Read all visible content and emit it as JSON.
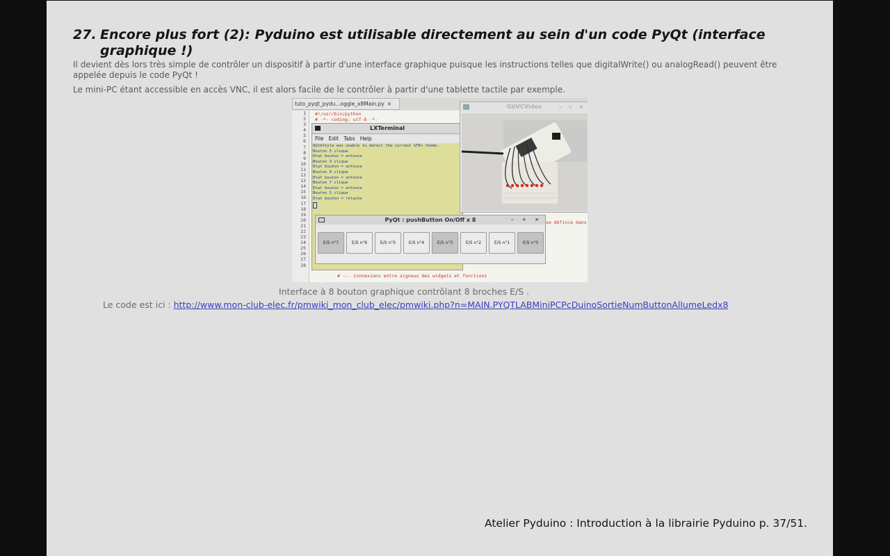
{
  "slide": {
    "heading_number": "27.",
    "heading_text": "Encore plus fort (2): Pyduino est utilisable directement au sein d'un code PyQt (interface graphique !)",
    "para1": "Il devient dès lors très simple de contrôler un dispositif à partir d'une interface graphique puisque les instructions telles que digitalWrite() ou analogRead() peuvent être appelée depuis le code PyQt !",
    "para2": "Le mini-PC étant accessible en accès VNC, il est alors facile de le contrôler à partir d'une tablette tactile par exemple.",
    "caption": "Interface à 8 bouton graphique contrôlant 8 broches E/S .",
    "code_prefix": "Le code est ici : ",
    "code_link": "http://www.mon-club-elec.fr/pmwiki_mon_club_elec/pmwiki.php?n=MAIN.PYQTLABMiniPCPcDuinoSortieNumButtonAllumeLedx8",
    "footer": "Atelier Pyduino : Introduction à la librairie Pyduino p. 37/51."
  },
  "screenshot": {
    "editor_tab": "tuto_pyqt_pydu...oggle_x8Main.py",
    "editor_tab_close": "×",
    "line_numbers": [
      "1",
      "2",
      "3",
      "4",
      "5",
      "6",
      "7",
      "8",
      "9",
      "10",
      "11",
      "12",
      "13",
      "14",
      "15",
      "16",
      "17",
      "18",
      "19",
      "20",
      "21",
      "22",
      "23",
      "24",
      "25",
      "26",
      "27",
      "28"
    ],
    "code_line_1": "#!/usr/bin/python",
    "code_line_2": "# -*- coding: utf-8 -*-",
    "code_line_28": "# --- Connexions entre signaux des widgets et fonctions",
    "code_right": "se définie dans",
    "terminal": {
      "title": "LXTerminal",
      "menu": [
        "File",
        "Edit",
        "Tabs",
        "Help"
      ],
      "output": [
        "QGtkStyle was unable to detect the current GTK+ theme.",
        "Bouton 5 clique",
        "Etat bouton = enfonce",
        "Bouton 3 clique",
        "Etat bouton = enfonce",
        "Bouton 0 clique",
        "Etat bouton = enfonce",
        "Bouton 7 clique",
        "Etat bouton = enfonce",
        "Bouton 5 clique",
        "Etat bouton = relache"
      ]
    },
    "video": {
      "title": "GUVCVideo",
      "controls": "– ▫ ×"
    },
    "pyqt": {
      "title": "PyQt : pushButton On/Off x 8",
      "controls": "– + ×",
      "buttons": [
        {
          "label": "E/S n°7",
          "on": true
        },
        {
          "label": "E/S n°6",
          "on": false
        },
        {
          "label": "E/S n°5",
          "on": false
        },
        {
          "label": "E/S n°4",
          "on": false
        },
        {
          "label": "E/S n°3",
          "on": true
        },
        {
          "label": "E/S n°2",
          "on": false
        },
        {
          "label": "E/S n°1",
          "on": false
        },
        {
          "label": "E/S n°0",
          "on": true
        }
      ]
    }
  }
}
